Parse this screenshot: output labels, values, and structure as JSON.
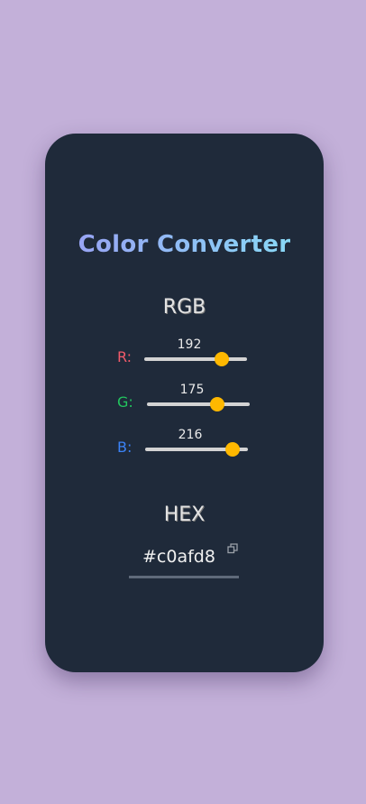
{
  "title": "Color Converter",
  "rgb": {
    "heading": "RGB",
    "channels": [
      {
        "label": "R:",
        "value": 192,
        "color": "#f05a6a"
      },
      {
        "label": "G:",
        "value": 175,
        "color": "#22c55e"
      },
      {
        "label": "B:",
        "value": 216,
        "color": "#3b82f6"
      }
    ]
  },
  "hex": {
    "heading": "HEX",
    "value": "#c0afd8"
  },
  "colors": {
    "background": "#c3b0d9",
    "card": "#1f2a3a",
    "thumb": "#ffb800"
  }
}
